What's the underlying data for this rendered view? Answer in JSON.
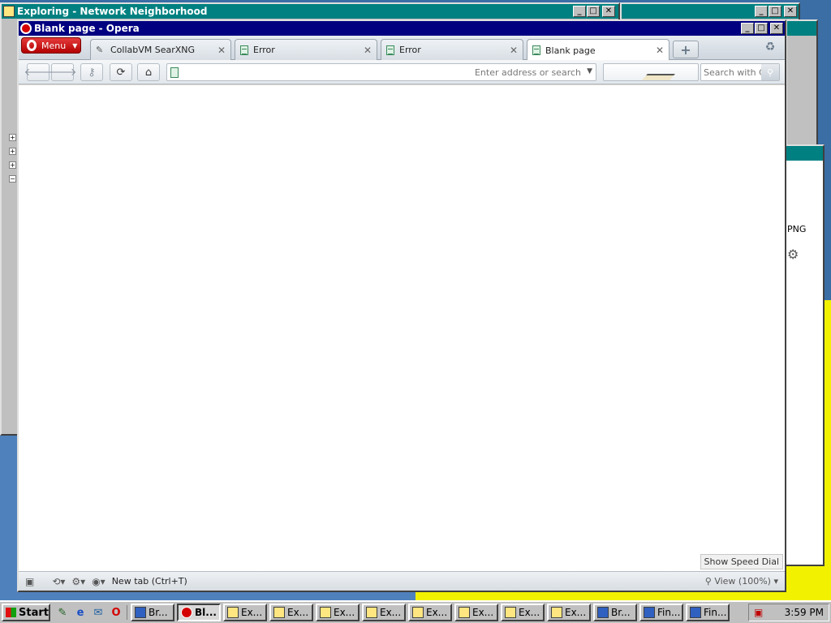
{
  "explorer": {
    "title": "Exploring - Network Neighborhood",
    "minimize": "_",
    "maximize": "□",
    "close": "✕"
  },
  "opera": {
    "title": "Blank page - Opera",
    "menu_label": "Menu",
    "tabs": [
      {
        "label": "CollabVM SearXNG",
        "close": "✕"
      },
      {
        "label": "Error",
        "close": "✕"
      },
      {
        "label": "Error",
        "close": "✕"
      },
      {
        "label": "Blank page",
        "close": "✕"
      }
    ],
    "new_tab_symbol": "+",
    "address_placeholder": "Enter address or search",
    "search_placeholder": "Search with Co",
    "speed_dial_label": "Show Speed Dial",
    "status_new_tab": "New tab (Ctrl+T)",
    "zoom_label": "View (100%)"
  },
  "rw3": {
    "png_label": "PNG"
  },
  "taskbar": {
    "start_label": "Start",
    "tasks": [
      {
        "label": "Br...",
        "icon": "browser-icon"
      },
      {
        "label": "Bl...",
        "icon": "opera-icon"
      },
      {
        "label": "Ex...",
        "icon": "folder-icon"
      },
      {
        "label": "Ex...",
        "icon": "folder-icon"
      },
      {
        "label": "Ex...",
        "icon": "folder-icon"
      },
      {
        "label": "Ex...",
        "icon": "folder-icon"
      },
      {
        "label": "Ex...",
        "icon": "folder-icon"
      },
      {
        "label": "Ex...",
        "icon": "folder-icon"
      },
      {
        "label": "Ex...",
        "icon": "folder-icon"
      },
      {
        "label": "Ex...",
        "icon": "folder-icon"
      },
      {
        "label": "Br...",
        "icon": "browser-icon"
      },
      {
        "label": "Fin...",
        "icon": "find-icon"
      },
      {
        "label": "Fin...",
        "icon": "find-icon"
      }
    ],
    "clock": "3:59 PM"
  },
  "colors": {
    "desktop": "#3a6ea5",
    "title_active": "#000080",
    "title_inactive": "#008080",
    "opera_red": "#d40000"
  }
}
